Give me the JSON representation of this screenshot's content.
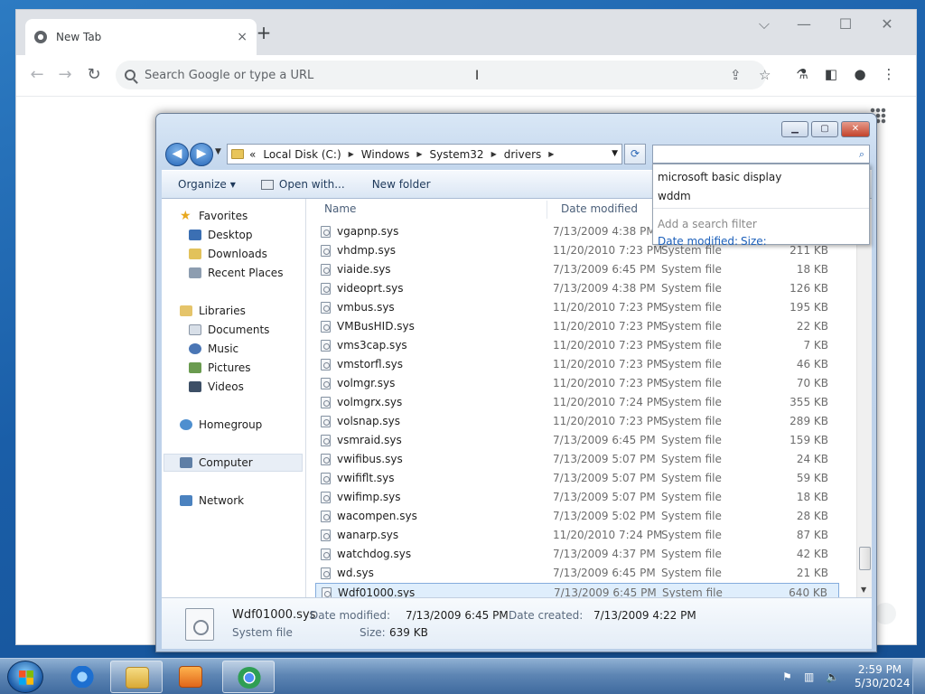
{
  "chrome": {
    "tab_title": "New Tab",
    "tab_close": "×",
    "new_tab": "+",
    "window_controls": {
      "dropdown": "⌵",
      "minimize": "—",
      "maximize": "☐",
      "close": "✕"
    },
    "nav": {
      "back": "←",
      "forward": "→",
      "reload": "↻"
    },
    "omnibox_placeholder": "Search Google or type a URL",
    "toolbar_icons": [
      "share-icon",
      "bookmark-star-icon",
      "labs-flask-icon",
      "side-panel-icon",
      "profile-icon",
      "menu-icon"
    ],
    "toolbar_glyphs": {
      "share": "⇪",
      "star": "☆",
      "labs": "⚗",
      "side_panel": "◧",
      "profile": "●",
      "menu": "⋮"
    }
  },
  "explorer": {
    "window_controls": {
      "minimize": "▁",
      "maximize": "▢",
      "close": "✕"
    },
    "nav": {
      "back": "◀",
      "forward": "▶",
      "history": "▼"
    },
    "address": {
      "overflow": "«",
      "crumbs": [
        "Local Disk (C:)",
        "Windows",
        "System32",
        "drivers"
      ],
      "sep": "▶",
      "dropdown": "▼"
    },
    "refresh": "⟳",
    "search_value": "",
    "search_icon": "⌕",
    "search_suggestions": [
      "microsoft basic display",
      "wddm"
    ],
    "search_hint": "Add a search filter",
    "search_filters": [
      "Date modified:",
      "Size:"
    ],
    "commands": {
      "organize": "Organize",
      "open_with": "Open with...",
      "new_folder": "New folder",
      "caret": "▼"
    },
    "nav_pane": {
      "favorites": "Favorites",
      "favorites_items": [
        "Desktop",
        "Downloads",
        "Recent Places"
      ],
      "libraries": "Libraries",
      "libraries_items": [
        "Documents",
        "Music",
        "Pictures",
        "Videos"
      ],
      "homegroup": "Homegroup",
      "computer": "Computer",
      "network": "Network"
    },
    "columns": {
      "name": "Name",
      "date": "Date modified"
    },
    "files": [
      {
        "name": "vgapnp.sys",
        "date": "7/13/2009 4:38 PM",
        "type": "",
        "size": ""
      },
      {
        "name": "vhdmp.sys",
        "date": "11/20/2010 7:23 PM",
        "type": "System file",
        "size": "211 KB"
      },
      {
        "name": "viaide.sys",
        "date": "7/13/2009 6:45 PM",
        "type": "System file",
        "size": "18 KB"
      },
      {
        "name": "videoprt.sys",
        "date": "7/13/2009 4:38 PM",
        "type": "System file",
        "size": "126 KB"
      },
      {
        "name": "vmbus.sys",
        "date": "11/20/2010 7:23 PM",
        "type": "System file",
        "size": "195 KB"
      },
      {
        "name": "VMBusHID.sys",
        "date": "11/20/2010 7:23 PM",
        "type": "System file",
        "size": "22 KB"
      },
      {
        "name": "vms3cap.sys",
        "date": "11/20/2010 7:23 PM",
        "type": "System file",
        "size": "7 KB"
      },
      {
        "name": "vmstorfl.sys",
        "date": "11/20/2010 7:23 PM",
        "type": "System file",
        "size": "46 KB"
      },
      {
        "name": "volmgr.sys",
        "date": "11/20/2010 7:23 PM",
        "type": "System file",
        "size": "70 KB"
      },
      {
        "name": "volmgrx.sys",
        "date": "11/20/2010 7:24 PM",
        "type": "System file",
        "size": "355 KB"
      },
      {
        "name": "volsnap.sys",
        "date": "11/20/2010 7:23 PM",
        "type": "System file",
        "size": "289 KB"
      },
      {
        "name": "vsmraid.sys",
        "date": "7/13/2009 6:45 PM",
        "type": "System file",
        "size": "159 KB"
      },
      {
        "name": "vwifibus.sys",
        "date": "7/13/2009 5:07 PM",
        "type": "System file",
        "size": "24 KB"
      },
      {
        "name": "vwififlt.sys",
        "date": "7/13/2009 5:07 PM",
        "type": "System file",
        "size": "59 KB"
      },
      {
        "name": "vwifimp.sys",
        "date": "7/13/2009 5:07 PM",
        "type": "System file",
        "size": "18 KB"
      },
      {
        "name": "wacompen.sys",
        "date": "7/13/2009 5:02 PM",
        "type": "System file",
        "size": "28 KB"
      },
      {
        "name": "wanarp.sys",
        "date": "11/20/2010 7:24 PM",
        "type": "System file",
        "size": "87 KB"
      },
      {
        "name": "watchdog.sys",
        "date": "7/13/2009 4:37 PM",
        "type": "System file",
        "size": "42 KB"
      },
      {
        "name": "wd.sys",
        "date": "7/13/2009 6:45 PM",
        "type": "System file",
        "size": "21 KB"
      },
      {
        "name": "Wdf01000.sys",
        "date": "7/13/2009 6:45 PM",
        "type": "System file",
        "size": "640 KB",
        "selected": true
      }
    ],
    "scroll_down": "▼",
    "details": {
      "name": "Wdf01000.sys",
      "type": "System file",
      "modified_label": "Date modified:",
      "modified": "7/13/2009 6:45 PM",
      "created_label": "Date created:",
      "created": "7/13/2009 4:22 PM",
      "size_label": "Size:",
      "size": "639 KB"
    }
  },
  "taskbar": {
    "time": "2:59 PM",
    "date": "5/30/2024",
    "tray_icons": [
      "action-center-flag-icon",
      "network-icon",
      "volume-muted-icon"
    ],
    "tray_glyphs": {
      "flag": "⚑",
      "network": "▥",
      "volume": "🔈"
    }
  },
  "colors": {
    "accent": "#1b5fba",
    "selection": "#dfeefc",
    "desktop": "#1a5ea8"
  }
}
